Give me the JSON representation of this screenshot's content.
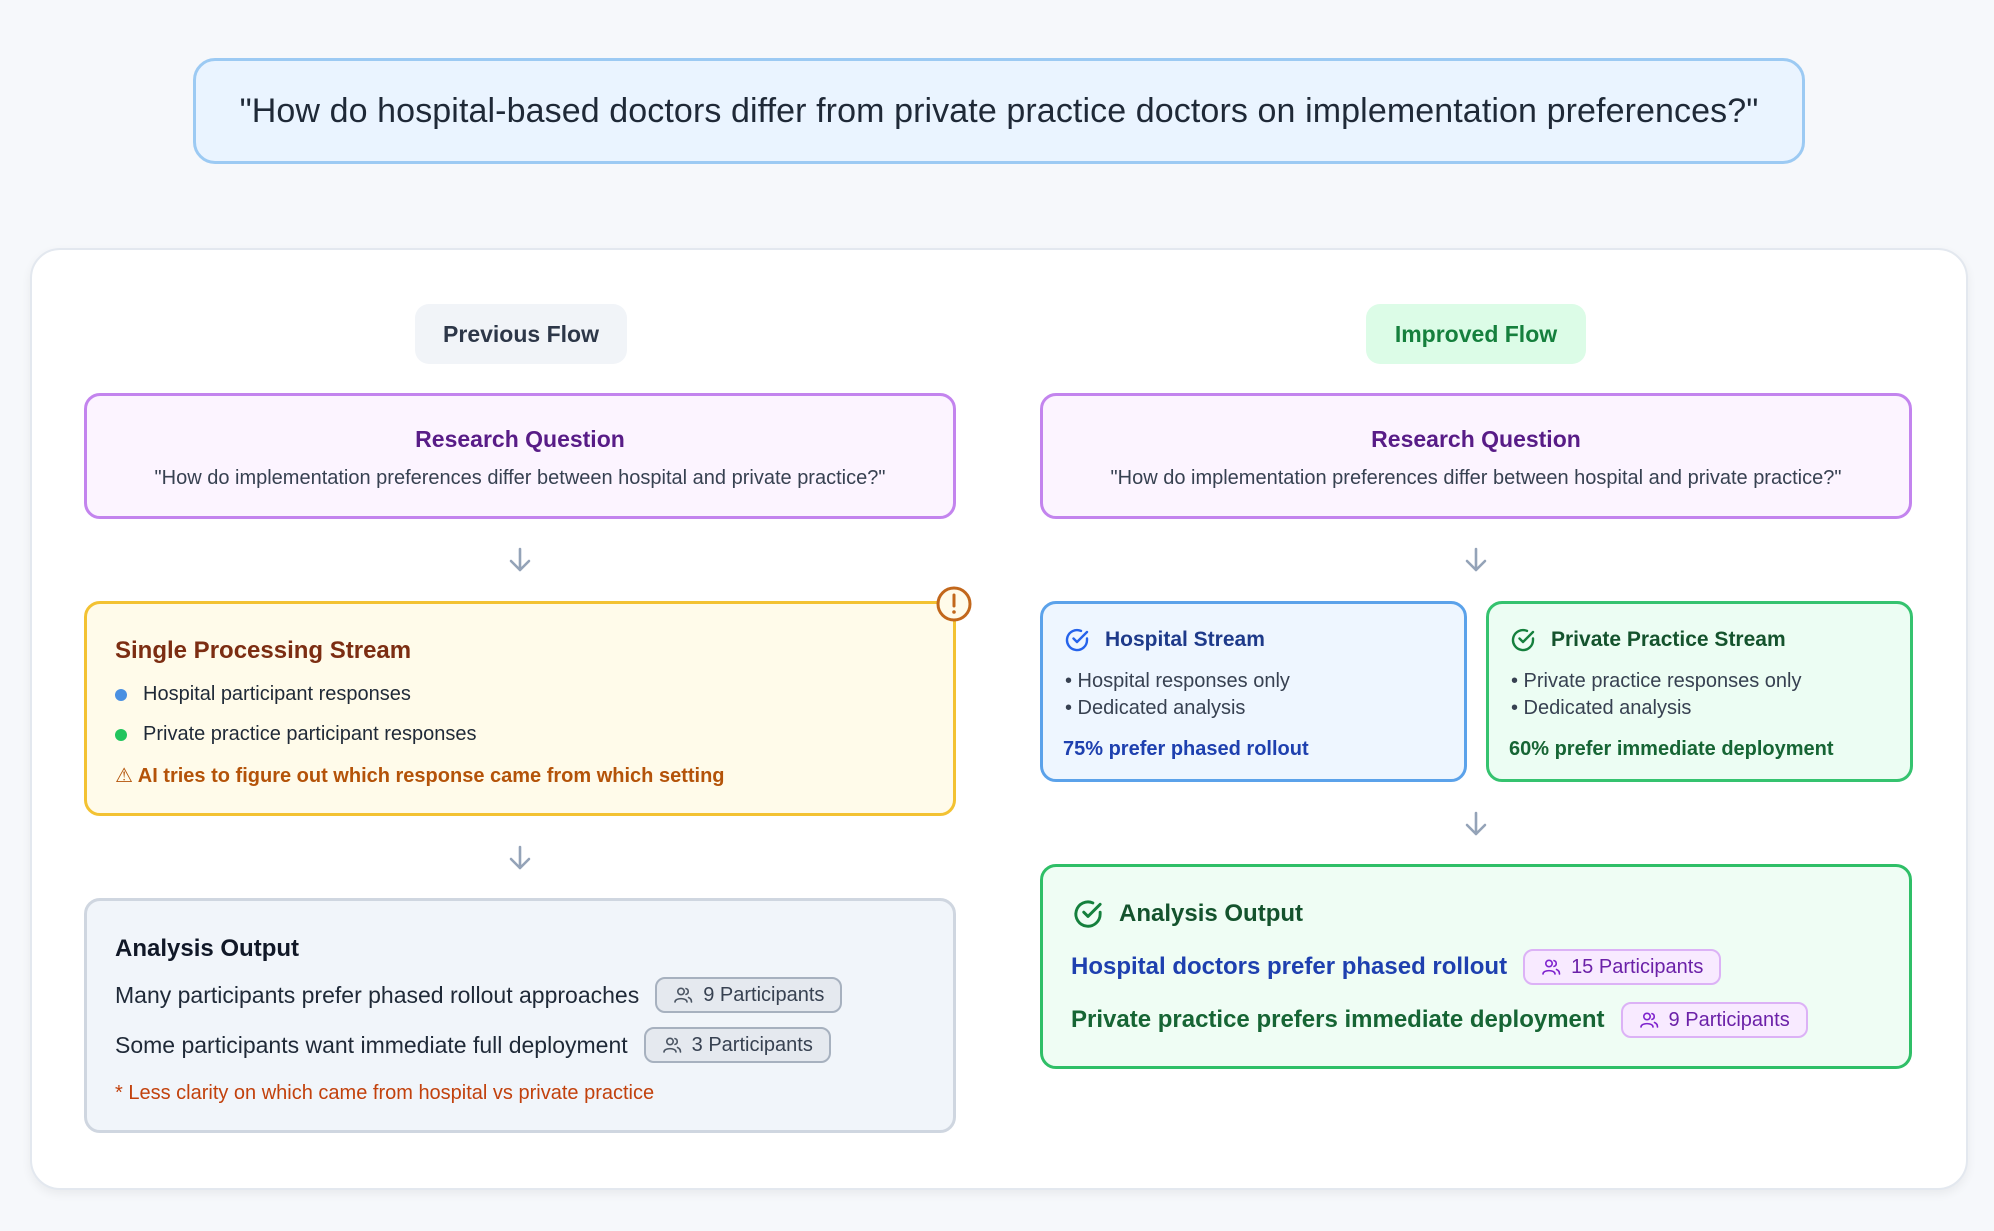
{
  "banner": {
    "question": "\"How do hospital-based doctors differ from private practice doctors on implementation preferences?\""
  },
  "previous": {
    "label": "Previous Flow",
    "research_question": {
      "title": "Research Question",
      "text": "\"How do implementation preferences differ between hospital and private practice?\""
    },
    "stream": {
      "title": "Single Processing Stream",
      "bullets": [
        "Hospital participant responses",
        "Private practice participant responses"
      ],
      "bullet_colors": [
        "#4a90e2",
        "#22c55e"
      ],
      "warning": "⚠ AI tries to figure out which response came from which setting"
    },
    "output": {
      "title": "Analysis Output",
      "rows": [
        {
          "text": "Many participants prefer phased rollout approaches",
          "badge": "9 Participants"
        },
        {
          "text": "Some participants want immediate full deployment",
          "badge": "3 Participants"
        }
      ],
      "note": "* Less clarity on which came from hospital vs private practice"
    }
  },
  "improved": {
    "label": "Improved Flow",
    "research_question": {
      "title": "Research Question",
      "text": "\"How do implementation preferences differ between hospital and private practice?\""
    },
    "hospital_stream": {
      "title": "Hospital Stream",
      "lines": [
        "• Hospital responses only",
        "• Dedicated analysis"
      ],
      "stat": "75% prefer phased rollout"
    },
    "private_stream": {
      "title": "Private Practice Stream",
      "lines": [
        "• Private practice responses only",
        "• Dedicated analysis"
      ],
      "stat": "60% prefer immediate deployment"
    },
    "output": {
      "title": "Analysis Output",
      "rows": [
        {
          "text": "Hospital doctors prefer phased rollout",
          "badge": "15 Participants"
        },
        {
          "text": "Private practice prefers immediate deployment",
          "badge": "9 Participants"
        }
      ]
    }
  },
  "colors": {
    "hospital_dot": "#4a90e2",
    "private_dot": "#22c55e",
    "arrow": "#94a3b8",
    "alert": "#c2671b"
  },
  "icons": {
    "arrow": "arrow-down-icon",
    "check": "check-circle-icon",
    "users": "users-icon",
    "alert": "alert-circle-icon"
  }
}
